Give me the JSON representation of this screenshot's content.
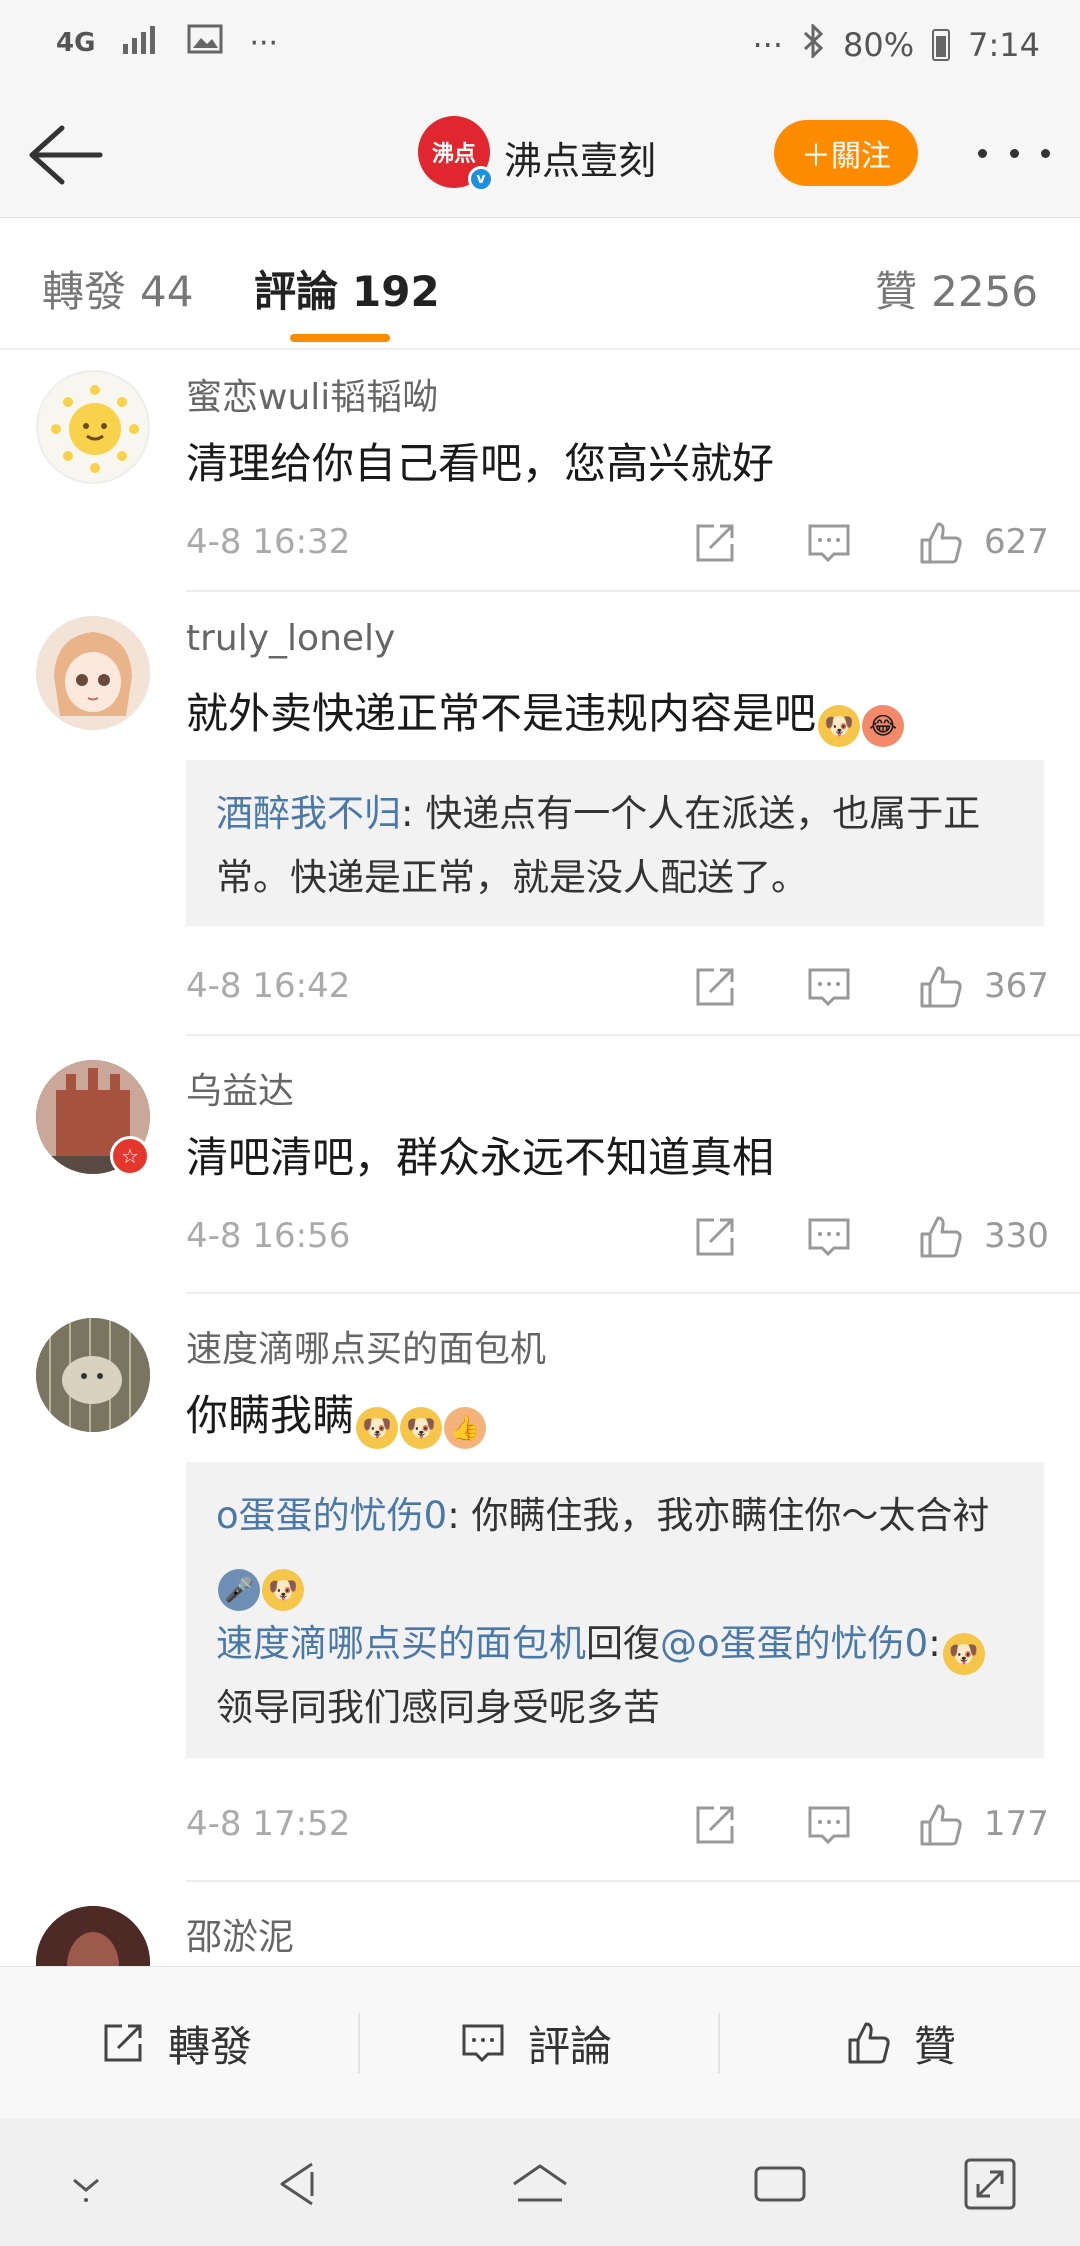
{
  "status_bar": {
    "network": "4G",
    "more": "···",
    "right_more": "···",
    "battery": "80%",
    "time": "7:14"
  },
  "header": {
    "account_name": "沸点壹刻",
    "avatar_text": "沸点",
    "verified_mark": "v",
    "follow_label": "＋關注"
  },
  "tabs": [
    {
      "label": "轉發",
      "count": "44"
    },
    {
      "label": "評論",
      "count": "192"
    },
    {
      "label": "贊",
      "count": "2256"
    }
  ],
  "comments": [
    {
      "username": "蜜恋wuli韬韬呦",
      "text": "清理给你自己看吧，您高兴就好",
      "time": "4-8 16:32",
      "likes": "627"
    },
    {
      "username": "truly_lonely",
      "text": "就外卖快递正常不是违规内容是吧",
      "reply": {
        "user": "酒醉我不归",
        "text": ": 快递点有一个人在派送，也属于正常。快递是正常，就是没人配送了。"
      },
      "time": "4-8 16:42",
      "likes": "367"
    },
    {
      "username": "乌益达",
      "text": "清吧清吧，群众永远不知道真相",
      "time": "4-8 16:56",
      "likes": "330"
    },
    {
      "username": "速度滴哪点买的面包机",
      "text": "你瞒我瞒",
      "reply": {
        "user": "o蛋蛋的忧伤0",
        "text": ": 你瞒住我，我亦瞒住你～太合衬",
        "reply2_user": "速度滴哪点买的面包机",
        "reply2_mid": "回復",
        "reply2_target": "@o蛋蛋的忧伤0",
        "reply2_text": "领导同我们感同身受呢多苦"
      },
      "time": "4-8 17:52",
      "likes": "177"
    },
    {
      "username": "邵淤泥"
    }
  ],
  "bottom_bar": {
    "repost_label": "轉發",
    "comment_label": "評論",
    "like_label": "贊"
  },
  "colors": {
    "accent": "#ff8b00",
    "link": "#4a78a8",
    "brand_red": "#e0262e",
    "verified_blue": "#1d8fe1"
  }
}
